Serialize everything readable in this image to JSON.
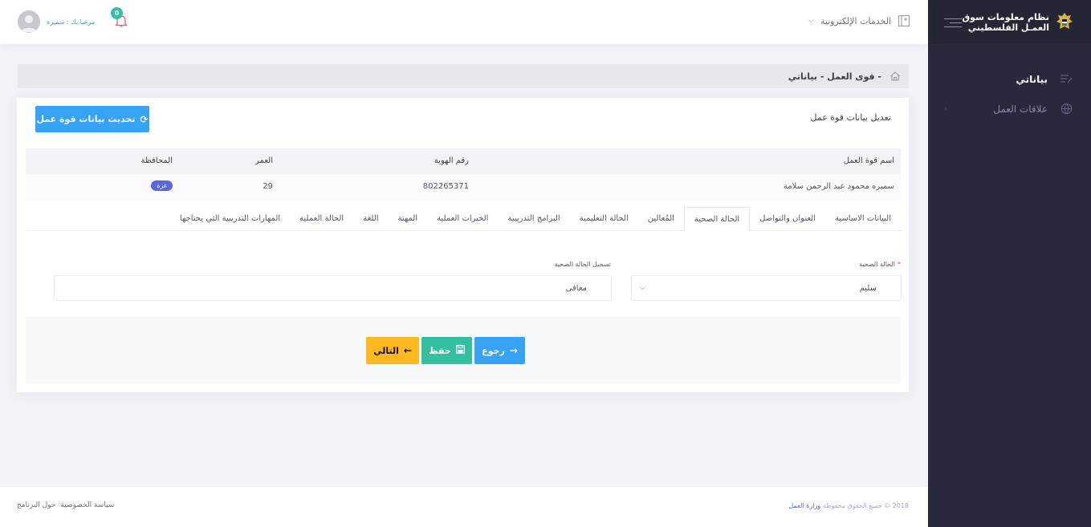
{
  "brand": {
    "line1": "نظام معلومات سوق",
    "line2": "العمـل الفلسطيني"
  },
  "sidebar": {
    "items": [
      {
        "label": "بياناتي"
      },
      {
        "label": "علاقات العمل"
      }
    ]
  },
  "header": {
    "eservices_label": "الخدمات الإلكترونية",
    "notification_count": "0",
    "greeting": "مرحبا بك : سميره"
  },
  "breadcrumb": {
    "text": "- قوى العمل - بياناتي"
  },
  "portlet": {
    "title": "تعديل بيانات قوة عمل",
    "refresh_label": "تحديث بيانات قوة عمل"
  },
  "info_table": {
    "headers": [
      "اسم قوة العمل",
      "رقم الهوية",
      "العمر",
      "المحافظة"
    ],
    "row": {
      "name": "سميره محمود عبد الرحمن سلامة",
      "id": "802265371",
      "age": "29",
      "governorate": "غزة"
    }
  },
  "tabs": [
    "البيانات الاساسية",
    "العنوان والتواصل",
    "الحالة الصحية",
    "المُعالين",
    "الحالة التعليمية",
    "البرامج التدريبية",
    "الخبرات العملية",
    "المهنة",
    "اللغة",
    "الحالة العملية",
    "المهارات التدريبية التي يحتاجها"
  ],
  "active_tab": "الحالة الصحية",
  "form": {
    "health_status_label": "الحالة الصحية",
    "health_status_value": "سليم",
    "health_record_label": "تسجيل الحالة الصحية",
    "health_record_value": "معافى"
  },
  "buttons": {
    "back": "رجوع",
    "save": "حفظ",
    "next": "التالي"
  },
  "footer": {
    "copyright": "2018 © جميع الحقوق محفوظة",
    "ministry": "وزارة العمل",
    "links": [
      "سياسة الخصوصية",
      "حول البرنامج"
    ]
  },
  "colors": {
    "sidebar": "#282a3c",
    "primary": "#36a3f7",
    "success": "#34bfa3",
    "warning": "#ffb822",
    "badge": "#5867dd"
  }
}
